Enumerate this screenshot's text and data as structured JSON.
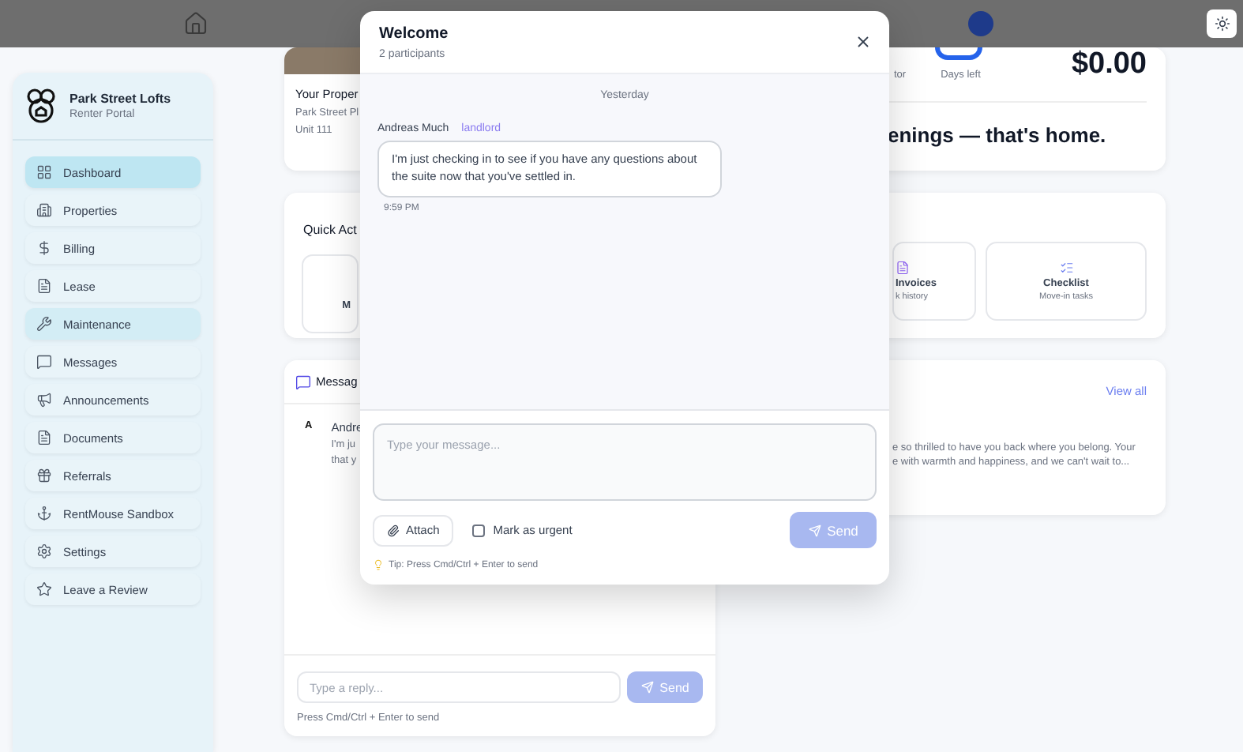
{
  "sidebar": {
    "title": "Park Street Lofts",
    "subtitle": "Renter Portal",
    "items": [
      {
        "label": "Dashboard",
        "selected": true,
        "highlighted": false
      },
      {
        "label": "Properties",
        "selected": false,
        "highlighted": false
      },
      {
        "label": "Billing",
        "selected": false,
        "highlighted": false
      },
      {
        "label": "Lease",
        "selected": false,
        "highlighted": false
      },
      {
        "label": "Maintenance",
        "selected": false,
        "highlighted": true
      },
      {
        "label": "Messages",
        "selected": false,
        "highlighted": false
      },
      {
        "label": "Announcements",
        "selected": false,
        "highlighted": false
      },
      {
        "label": "Documents",
        "selected": false,
        "highlighted": false
      },
      {
        "label": "Referrals",
        "selected": false,
        "highlighted": false
      },
      {
        "label": "RentMouse Sandbox",
        "selected": false,
        "highlighted": false
      },
      {
        "label": "Settings",
        "selected": false,
        "highlighted": false
      },
      {
        "label": "Leave a Review",
        "selected": false,
        "highlighted": false
      }
    ]
  },
  "property_card": {
    "title": "Your Proper",
    "address": "Park Street Pl",
    "unit": "Unit 111"
  },
  "quick_actions": {
    "title": "Quick Act",
    "left_tile": "M",
    "tiles": [
      {
        "title": "Invoices",
        "subtitle": "k history"
      },
      {
        "title": "Checklist",
        "subtitle": "Move-in tasks"
      }
    ]
  },
  "messages_card": {
    "title": "Messag",
    "avatar": "A",
    "sender": "Andre",
    "preview_lines": [
      "I'm ju",
      "that y"
    ],
    "reply_placeholder": "Type a reply...",
    "send": "Send",
    "hint": "Press Cmd/Ctrl + Enter to send"
  },
  "stats_card": {
    "label_1": "tor",
    "label_2": "Days left",
    "amount": "$0.00",
    "quote": "enings — that's home."
  },
  "announcements": {
    "view_all": "View all",
    "lines": [
      "e so thrilled to have you back where you belong. Your",
      "e with warmth and happiness, and we can't wait to..."
    ]
  },
  "modal": {
    "title": "Welcome",
    "subtitle": "2 participants",
    "date": "Yesterday",
    "messages": [
      {
        "sender": "Andreas Much",
        "role": "landlord",
        "text": "I'm just checking in to see if you have any questions about the suite now that you've settled in.",
        "time": "9:59 PM"
      }
    ],
    "placeholder": "Type your message...",
    "attach": "Attach",
    "urgent": {
      "label": "Mark as urgent",
      "checked": false
    },
    "send": "Send",
    "tip": "Tip: Press Cmd/Ctrl + Enter to send"
  }
}
